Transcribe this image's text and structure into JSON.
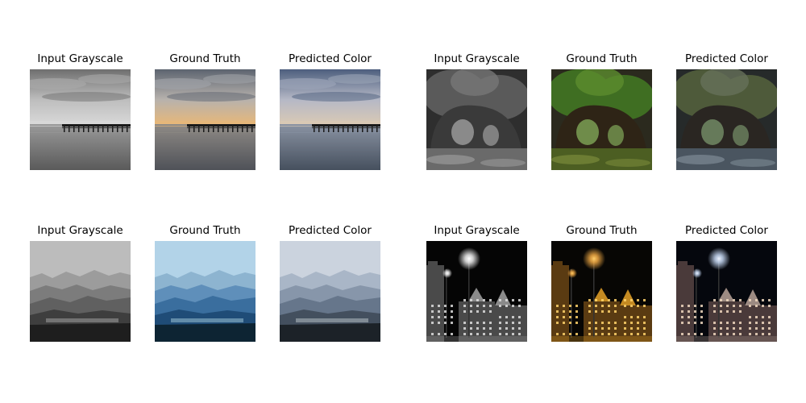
{
  "figure": {
    "groups": [
      {
        "scene": "pier",
        "panels": [
          {
            "title": "Input Grayscale",
            "variant": "gray"
          },
          {
            "title": "Ground Truth",
            "variant": "truth"
          },
          {
            "title": "Predicted Color",
            "variant": "pred"
          }
        ]
      },
      {
        "scene": "forest",
        "panels": [
          {
            "title": "Input Grayscale",
            "variant": "gray"
          },
          {
            "title": "Ground Truth",
            "variant": "truth"
          },
          {
            "title": "Predicted Color",
            "variant": "pred"
          }
        ]
      },
      {
        "scene": "mountains",
        "panels": [
          {
            "title": "Input Grayscale",
            "variant": "gray"
          },
          {
            "title": "Ground Truth",
            "variant": "truth"
          },
          {
            "title": "Predicted Color",
            "variant": "pred"
          }
        ]
      },
      {
        "scene": "city-night",
        "panels": [
          {
            "title": "Input Grayscale",
            "variant": "gray"
          },
          {
            "title": "Ground Truth",
            "variant": "truth"
          },
          {
            "title": "Predicted Color",
            "variant": "pred"
          }
        ]
      }
    ]
  }
}
